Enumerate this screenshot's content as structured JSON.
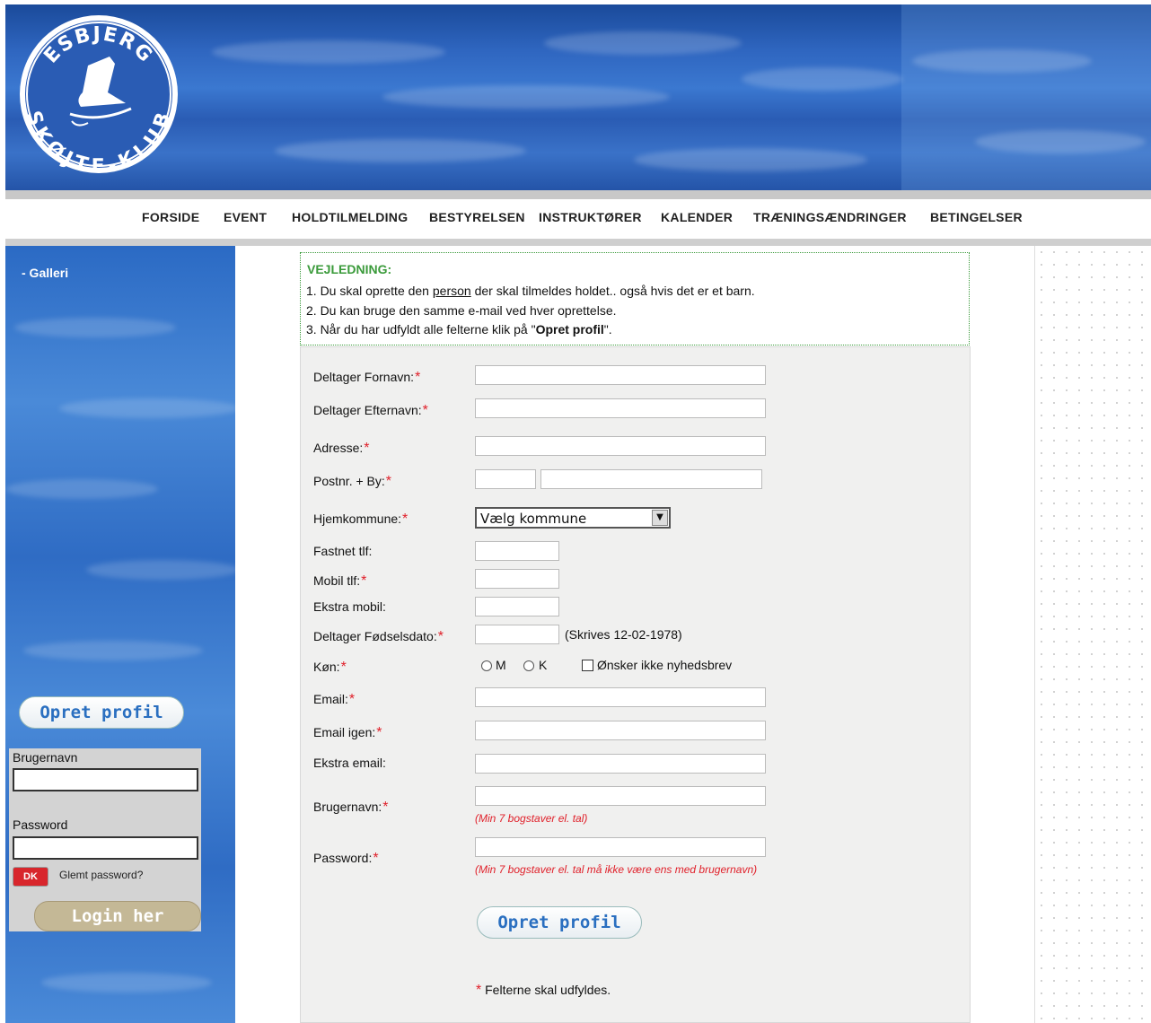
{
  "logo": {
    "top_text": "ESBJERG",
    "bottom_text": "SKØJTE-KLUB"
  },
  "nav": [
    "FORSIDE",
    "EVENT",
    "HOLDTILMELDING",
    "BESTYRELSEN",
    "INSTRUKTØRER",
    "KALENDER",
    "TRÆNINGSÆNDRINGER",
    "BETINGELSER"
  ],
  "sidebar": {
    "galleri": "- Galleri",
    "create_profile": "Opret profil",
    "username_label": "Brugernavn",
    "password_label": "Password",
    "dk_badge": "DK",
    "forgot": "Glemt password?",
    "login": "Login her"
  },
  "guide": {
    "title": "VEJLEDNING:",
    "line1_pre": "1. Du skal oprette den ",
    "line1_link": "person",
    "line1_post": " der skal tilmeldes holdet.. også hvis det er et barn.",
    "line2": "2. Du kan bruge den samme e-mail ved hver oprettelse.",
    "line3_pre": "3. Når du har udfyldt alle felterne klik på \"",
    "line3_bold": "Opret profil",
    "line3_post": "\"."
  },
  "form": {
    "first_name": "Deltager Fornavn:",
    "last_name": "Deltager Efternavn:",
    "address": "Adresse:",
    "postcode_city": "Postnr. + By:",
    "municipality": "Hjemkommune:",
    "municipality_value": "Vælg kommune",
    "landline": "Fastnet tlf:",
    "mobile": "Mobil tlf:",
    "extra_mobile": "Ekstra mobil:",
    "birthdate": "Deltager Fødselsdato:",
    "birthdate_hint": "(Skrives 12-02-1978)",
    "gender": "Køn:",
    "gender_m": "M",
    "gender_k": "K",
    "newsletter": "Ønsker ikke nyhedsbrev",
    "email": "Email:",
    "email_again": "Email igen:",
    "extra_email": "Ekstra email:",
    "username": "Brugernavn:",
    "username_hint": "(Min 7 bogstaver el. tal)",
    "password": "Password:",
    "password_hint": "(Min 7 bogstaver el. tal må ikke være ens med brugernavn)",
    "submit": "Opret profil",
    "required_star": "*",
    "footnote": "Felterne skal udfyldes."
  },
  "colors": {
    "banner_blue": "#2f66c0",
    "guide_green": "#3a9a3a",
    "required_red": "#e0202a",
    "button_text": "#2a6fc0",
    "login_button": "#c4b896"
  }
}
